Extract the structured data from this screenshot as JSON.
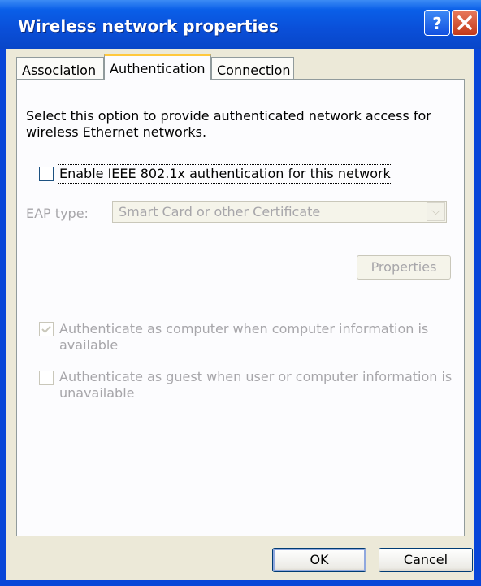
{
  "window": {
    "title": "Wireless network properties"
  },
  "title_buttons": {
    "help": "?",
    "close": "✕"
  },
  "tabs": [
    {
      "label": "Association",
      "active": false
    },
    {
      "label": "Authentication",
      "active": true
    },
    {
      "label": "Connection",
      "active": false
    }
  ],
  "auth": {
    "description_line1": "Select this option to provide authenticated network access for",
    "description_line2": "wireless Ethernet networks.",
    "enable_8021x_label": "Enable IEEE 802.1x authentication for this network",
    "enable_8021x_checked": false,
    "eap_type_label": "EAP type:",
    "eap_type_value": "Smart Card or other Certificate",
    "properties_button": "Properties",
    "auth_as_computer_label": "Authenticate as computer when computer information is available",
    "auth_as_computer_checked": true,
    "auth_as_guest_line1": "Authenticate as guest when user or computer information is",
    "auth_as_guest_line2": "unavailable",
    "auth_as_guest_checked": false
  },
  "buttons": {
    "ok": "OK",
    "cancel": "Cancel"
  },
  "colors": {
    "titlebar": "#0a5fe8",
    "dialog_bg": "#ece9d8",
    "tab_highlight": "#ffc83c",
    "disabled_text": "#a7a6aa"
  }
}
